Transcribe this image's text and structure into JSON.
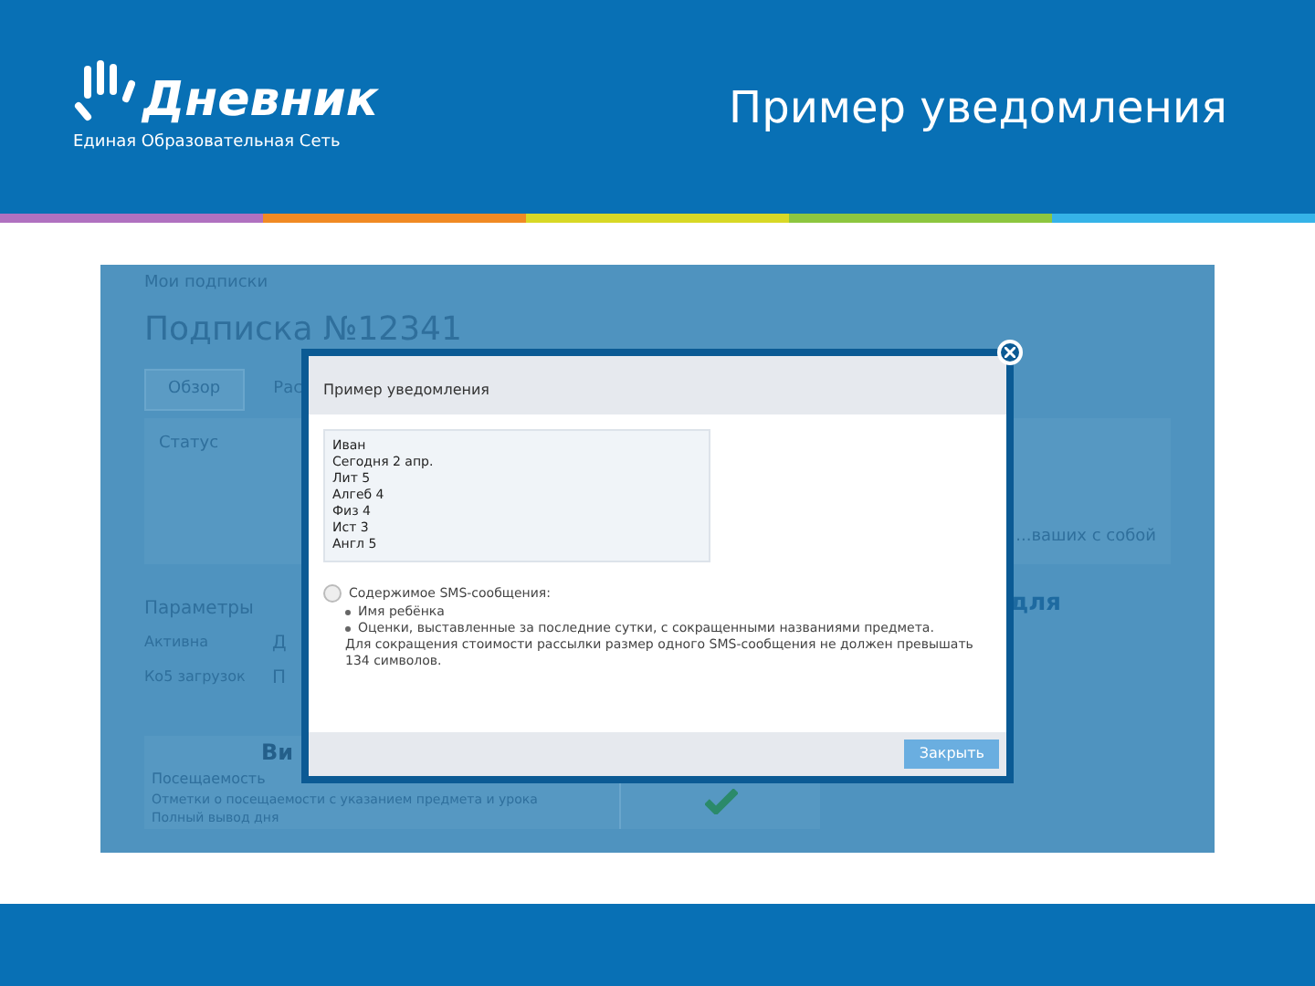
{
  "header": {
    "logo_name": "Дневник",
    "logo_tagline": "Единая Образовательная Сеть",
    "title": "Пример уведомления"
  },
  "screenshot": {
    "breadcrumb": "Мои подписки",
    "heading": "Подписка №12341",
    "tabs": [
      {
        "label": "Обзор",
        "selected": true
      },
      {
        "label": "Рас",
        "selected": false
      }
    ],
    "status_label": "Статус",
    "status_note": "...ваших с собой",
    "params_label": "Параметры",
    "params": [
      {
        "label": "Активна",
        "value": "Д"
      },
      {
        "label": "Ко5 загрузок",
        "value": "П"
      }
    ],
    "side_heading": "для",
    "section_heading": "Ви",
    "attendance_label": "Посещаемость",
    "attendance_rows": [
      "Отметки о посещаемости с указанием предмета и урока",
      "Полный вывод дня"
    ],
    "attendance_checked": true
  },
  "modal": {
    "title": "Пример уведомления",
    "message_lines": [
      "Иван",
      "Сегодня 2 апр.",
      "Лит 5",
      "Алгеб 4",
      "Физ 4",
      "Ист 3",
      "Англ 5"
    ],
    "info_heading": "Содержимое SMS-сообщения:",
    "bullets": [
      "Имя ребёнка",
      "Оценки, выставленные за последние сутки, с сокращенными названиями предмета."
    ],
    "note": "Для сокращения стоимости рассылки размер одного SMS-сообщения не должен превышать 134 символов.",
    "close_button": "Закрыть"
  }
}
